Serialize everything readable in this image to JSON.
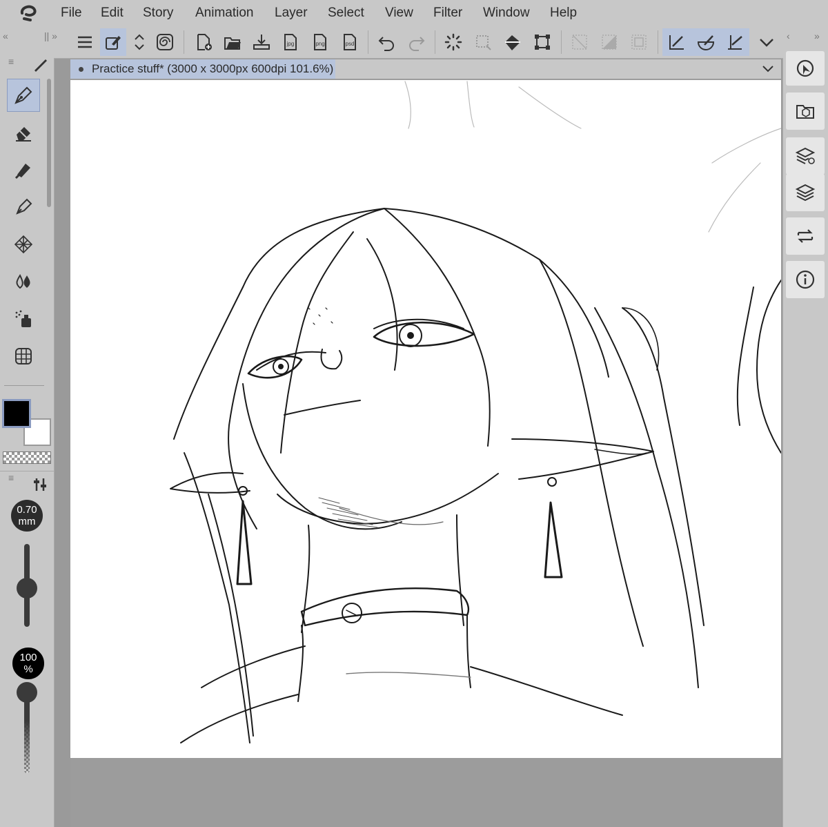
{
  "menu": {
    "items": [
      "File",
      "Edit",
      "Story",
      "Animation",
      "Layer",
      "Select",
      "View",
      "Filter",
      "Window",
      "Help"
    ]
  },
  "toolbar": {
    "export_labels": {
      "jpg": "jpg",
      "png": "png",
      "psd": "psd"
    }
  },
  "document": {
    "tab_title": "Practice stuff* (3000 x 3000px 600dpi 101.6%)"
  },
  "brush": {
    "size_value": "0.70",
    "size_unit": "mm",
    "opacity_value": "100",
    "opacity_unit": "%"
  },
  "colors": {
    "main": "#000000",
    "sub": "#ffffff",
    "panel": "#c8c8c8",
    "accent": "#b7c4dc"
  },
  "icons": {
    "left_tools": [
      "pen-icon",
      "eraser-icon",
      "fill-icon",
      "decoration-icon",
      "blend-icon",
      "ink-drop-icon",
      "airbrush-icon",
      "grid-icon"
    ],
    "right_panel": [
      "navigator-icon",
      "material-icon",
      "layer-property-icon",
      "layers-icon",
      "auto-action-icon",
      "info-icon"
    ]
  }
}
